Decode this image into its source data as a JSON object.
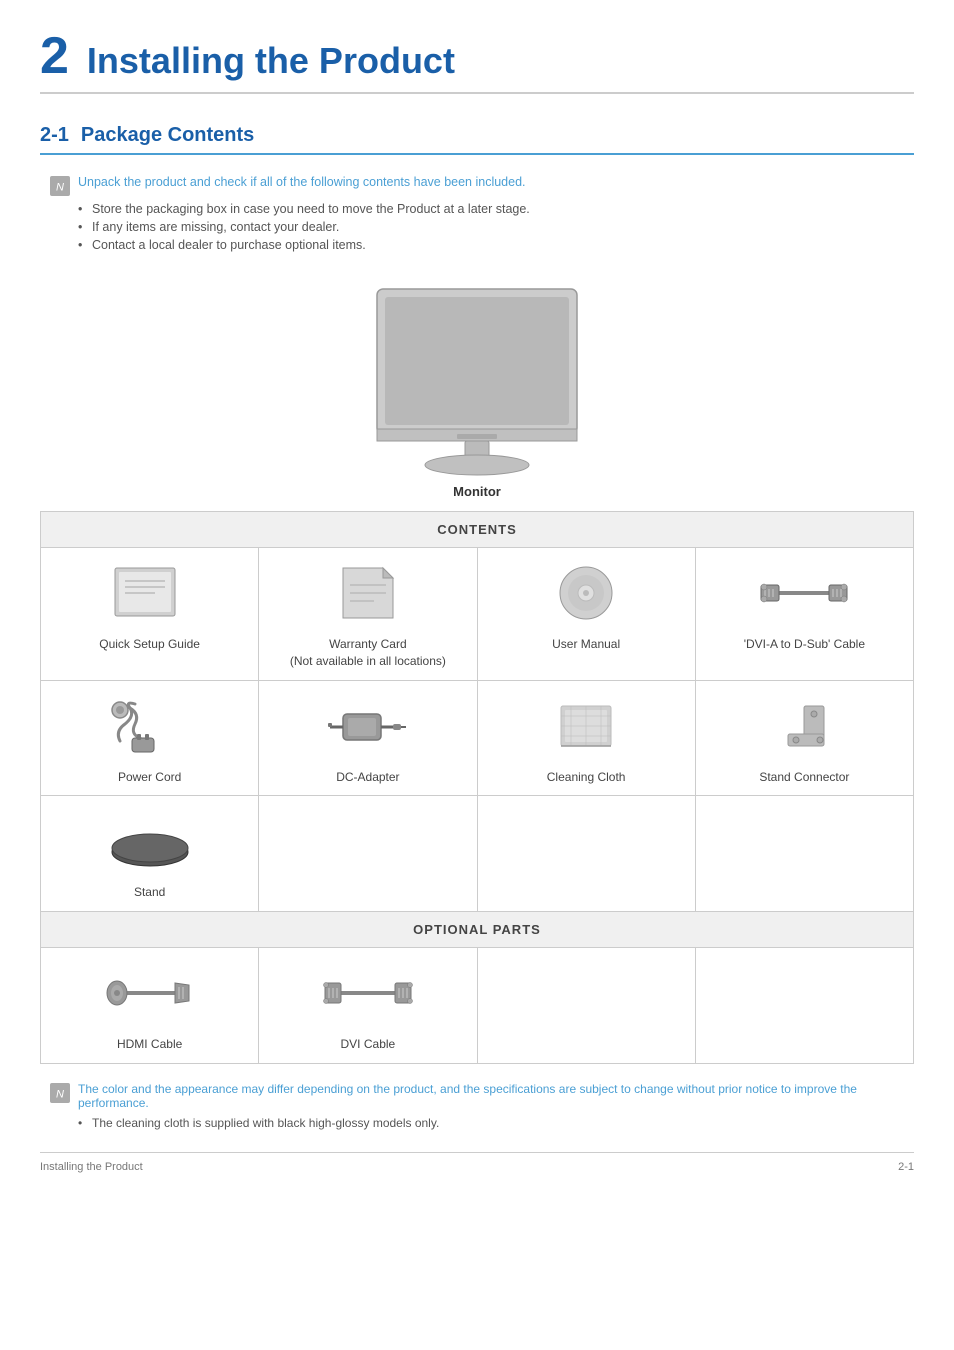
{
  "chapter": {
    "number": "2",
    "title": "Installing the Product"
  },
  "section": {
    "number": "2-1",
    "title": "Package Contents"
  },
  "intro_note": {
    "icon_label": "N",
    "main_text": "Unpack the product and check if all of the following contents have been included.",
    "sub_bullets": [
      "Store the packaging box in case you need to move the Product at a later stage.",
      "If any items are missing, contact your dealer.",
      "Contact a local dealer to purchase optional items."
    ]
  },
  "monitor_label": "Monitor",
  "contents_header": "CONTENTS",
  "optional_header": "OPTIONAL PARTS",
  "contents_items": [
    {
      "label": "Quick Setup Guide",
      "sublabel": ""
    },
    {
      "label": "Warranty Card",
      "sublabel": "(Not available in all locations)"
    },
    {
      "label": "User Manual",
      "sublabel": ""
    },
    {
      "label": "'DVI-A to D-Sub' Cable",
      "sublabel": ""
    },
    {
      "label": "Power Cord",
      "sublabel": ""
    },
    {
      "label": "DC-Adapter",
      "sublabel": ""
    },
    {
      "label": "Cleaning Cloth",
      "sublabel": ""
    },
    {
      "label": "Stand Connector",
      "sublabel": ""
    },
    {
      "label": "Stand",
      "sublabel": ""
    }
  ],
  "optional_items": [
    {
      "label": "HDMI Cable",
      "sublabel": ""
    },
    {
      "label": "DVI Cable",
      "sublabel": ""
    }
  ],
  "footer_notes": {
    "icon_label": "N",
    "main_text": "The color and the appearance may differ depending on the product, and the specifications are subject to change without prior notice to improve the performance.",
    "sub_bullets": [
      "The cleaning cloth is supplied with black high-glossy models only."
    ]
  },
  "page_footer": {
    "left": "Installing the Product",
    "right": "2-1"
  }
}
